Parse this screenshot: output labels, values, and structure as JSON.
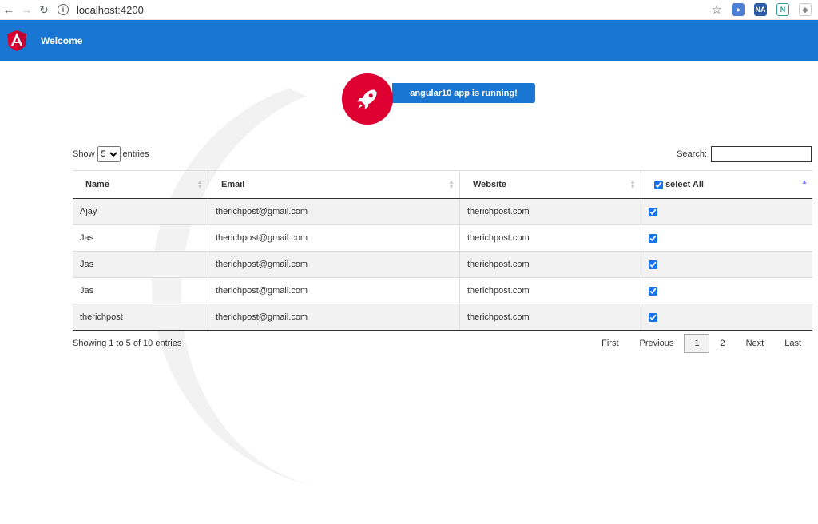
{
  "browser": {
    "url": "localhost:4200"
  },
  "header": {
    "title": "Welcome"
  },
  "banner": {
    "text": "angular10 app is running!"
  },
  "length": {
    "show_label": "Show",
    "selected": "5",
    "entries_label": "entries"
  },
  "search": {
    "label": "Search:",
    "value": ""
  },
  "table": {
    "columns": [
      "Name",
      "Email",
      "Website",
      "select All"
    ],
    "rows": [
      {
        "name": "Ajay",
        "email": "therichpost@gmail.com",
        "website": "therichpost.com",
        "checked": true
      },
      {
        "name": "Jas",
        "email": "therichpost@gmail.com",
        "website": "therichpost.com",
        "checked": true
      },
      {
        "name": "Jas",
        "email": "therichpost@gmail.com",
        "website": "therichpost.com",
        "checked": true
      },
      {
        "name": "Jas",
        "email": "therichpost@gmail.com",
        "website": "therichpost.com",
        "checked": true
      },
      {
        "name": "therichpost",
        "email": "therichpost@gmail.com",
        "website": "therichpost.com",
        "checked": true
      }
    ]
  },
  "info": "Showing 1 to 5 of 10 entries",
  "pager": {
    "first": "First",
    "previous": "Previous",
    "page1": "1",
    "page2": "2",
    "next": "Next",
    "last": "Last"
  },
  "colors": {
    "primary": "#1976d2",
    "angular_red": "#dd0031"
  }
}
